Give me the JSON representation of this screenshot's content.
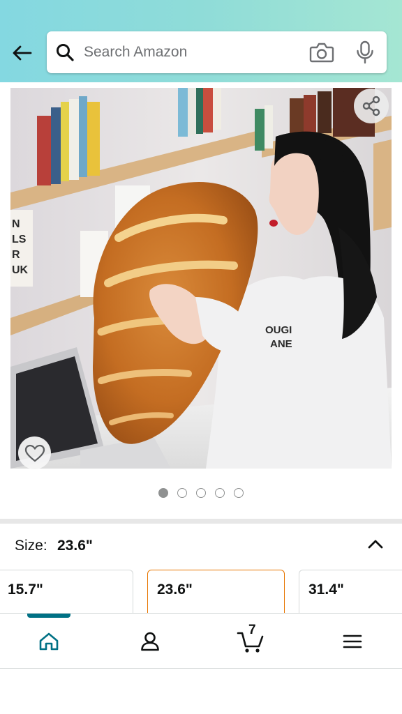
{
  "header": {
    "search_placeholder": "Search Amazon"
  },
  "gallery": {
    "image_count": 5,
    "active_index": 0,
    "image_description": "bread-loaf-pillow"
  },
  "size": {
    "label": "Size:",
    "selected": "23.6\"",
    "options": [
      {
        "label": "15.7\"",
        "selected": false
      },
      {
        "label": "23.6\"",
        "selected": true
      },
      {
        "label": "31.4\"",
        "selected": false
      }
    ]
  },
  "cart": {
    "count": "7"
  },
  "colors": {
    "accent": "#007185",
    "selected_border": "#e77600",
    "header_gradient_start": "#84d8e1",
    "header_gradient_end": "#a5e6d3"
  },
  "icons": {
    "back": "arrow-left-icon",
    "search": "search-icon",
    "camera": "camera-icon",
    "mic": "microphone-icon",
    "share": "share-icon",
    "wishlist": "heart-icon",
    "home": "home-icon",
    "account": "user-icon",
    "cart": "cart-icon",
    "menu": "menu-icon"
  }
}
